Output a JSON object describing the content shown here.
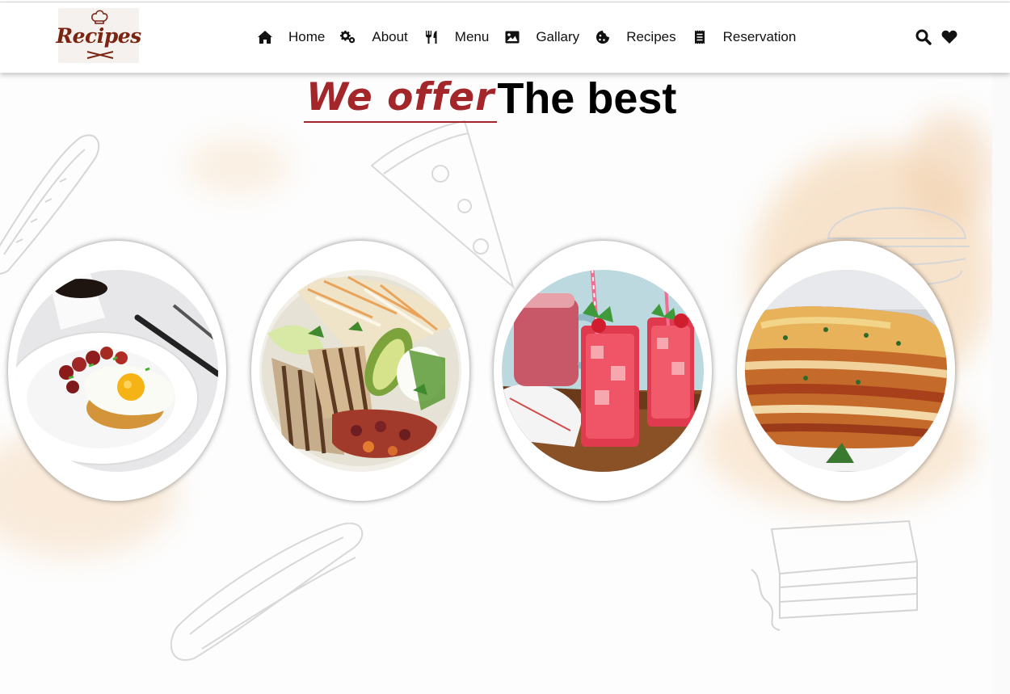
{
  "brand": {
    "logo_text": "Recipes"
  },
  "nav": {
    "items": [
      {
        "label": "Home",
        "icon": "home-icon"
      },
      {
        "label": "About",
        "icon": "gears-icon"
      },
      {
        "label": "Menu",
        "icon": "utensils-icon"
      },
      {
        "label": "Gallary",
        "icon": "image-icon"
      },
      {
        "label": "Recipes",
        "icon": "cookie-icon"
      },
      {
        "label": "Reservation",
        "icon": "receipt-icon"
      }
    ]
  },
  "actions": {
    "icons": [
      "search-icon",
      "heart-icon"
    ]
  },
  "hero": {
    "accent": "We offer",
    "title": "The best"
  },
  "dishes": [
    {
      "image": "fried egg toast with tomatoes"
    },
    {
      "image": "grilled chicken salad bowl"
    },
    {
      "image": "strawberry lemonade drinks"
    },
    {
      "image": "lasagna"
    }
  ],
  "colors": {
    "accent": "#a3262a",
    "logo": "#7a2412",
    "header_bg": "#ffffff",
    "text": "#111111"
  }
}
